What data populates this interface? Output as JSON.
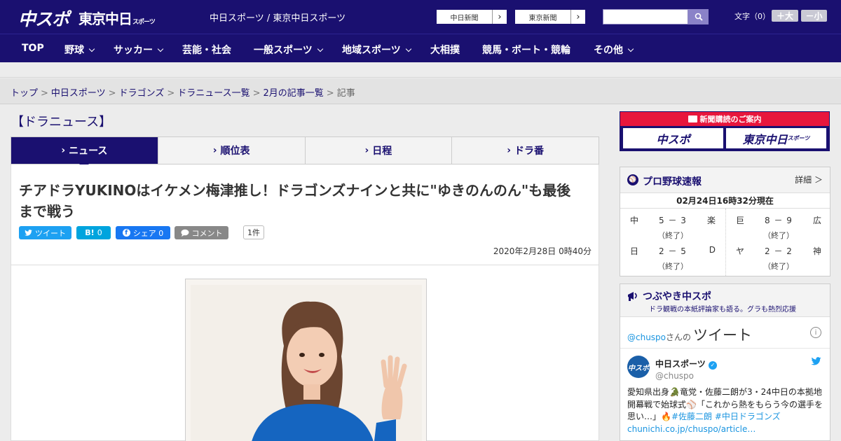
{
  "header": {
    "logo_main": "中スポ",
    "logo_sub": "東京中日",
    "logo_sub_small": "スポーツ",
    "title": "中日スポーツ / 東京中日スポーツ",
    "paper_buttons": [
      "中日新聞",
      "東京新聞"
    ],
    "font_label": "文字（0）",
    "font_plus": "＋大",
    "font_minus": "－小"
  },
  "nav": {
    "items": [
      {
        "label": "TOP",
        "has_menu": false
      },
      {
        "label": "野球",
        "has_menu": true
      },
      {
        "label": "サッカー",
        "has_menu": true
      },
      {
        "label": "芸能・社会",
        "has_menu": false
      },
      {
        "label": "一般スポーツ",
        "has_menu": true
      },
      {
        "label": "地域スポーツ",
        "has_menu": true
      },
      {
        "label": "大相撲",
        "has_menu": false
      },
      {
        "label": "競馬・ボート・競輪",
        "has_menu": false
      },
      {
        "label": "その他",
        "has_menu": true
      }
    ]
  },
  "breadcrumb": {
    "links": [
      "トップ",
      "中日スポーツ",
      "ドラゴンズ",
      "ドラニュース一覧",
      "2月の記事一覧"
    ],
    "current": "記事"
  },
  "main": {
    "section_title": "【ドラニュース】",
    "tabs": [
      {
        "label": "ニュース",
        "active": true
      },
      {
        "label": "順位表",
        "active": false
      },
      {
        "label": "日程",
        "active": false
      },
      {
        "label": "ドラ番",
        "active": false
      }
    ],
    "headline": "チアドラYUKINOはイケメン梅津推し！ドラゴンズナインと共に\"ゆきのんのん\"も最後まで戦う",
    "share": {
      "tweet": "ツイート",
      "hatena_icon": "B!",
      "hatena_count": "0",
      "facebook": "シェア 0",
      "comment": "コメント",
      "comment_count": "1件"
    },
    "date": "2020年2月28日 0時40分"
  },
  "sidebar": {
    "subscribe": {
      "title": "新聞購読のご案内",
      "buttons": [
        "中スポ",
        "東京中日"
      ],
      "button_small": "スポーツ"
    },
    "scores": {
      "title": "プロ野球速報",
      "more": "詳細 ＞",
      "stamp": "02月24日16時32分現在",
      "games": [
        {
          "home": "中",
          "score": "5 － 3",
          "away": "楽",
          "status": "（終了）"
        },
        {
          "home": "巨",
          "score": "8 － 9",
          "away": "広",
          "status": "（終了）"
        },
        {
          "home": "日",
          "score": "2 － 5",
          "away": "D",
          "status": "（終了）"
        },
        {
          "home": "ヤ",
          "score": "2 － 2",
          "away": "神",
          "status": "（終了）"
        }
      ]
    },
    "tweets": {
      "title": "つぶやき中スポ",
      "subtitle": "ドラ観戦の本紙評論家も語る。グラも熱烈応援",
      "handle": "@chuspo",
      "handle_suffix": "さんの",
      "heading": "ツイート",
      "author": "中日スポーツ",
      "author_handle": "@chuspo",
      "avatar_text": "中スポ",
      "text_1": "愛知県出身🐊竜党・佐藤二朗が3・24中日の本拠地開幕戦で始球式⚾「これから熱をもらう今の選手を思い…」🔥",
      "hashtags": "#佐藤二朗 #中日ドラゴンズ",
      "link": "chunichi.co.jp/chuspo/article…"
    }
  },
  "colors": {
    "brand": "#1a1070",
    "accent_red": "#e8163c",
    "twitter": "#1da1f2",
    "hatena": "#00a4de",
    "facebook": "#1877f2",
    "comment": "#888888"
  }
}
